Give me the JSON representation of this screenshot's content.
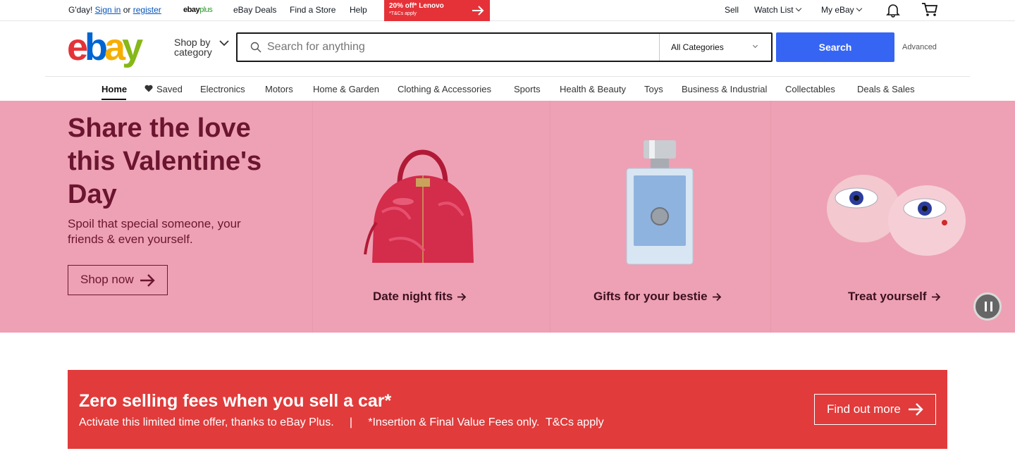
{
  "topbar": {
    "greeting": "G'day!",
    "sign_in": "Sign in",
    "or": "or",
    "register": "register",
    "ebay_plus_brand": "ebay",
    "ebay_plus_suffix": "plus",
    "links": [
      "eBay Deals",
      "Find a Store",
      "Help"
    ],
    "promo_line1": "20% off* Lenovo",
    "promo_line2": "*T&Cs apply",
    "sell": "Sell",
    "watch_list": "Watch List",
    "my_ebay": "My eBay"
  },
  "header": {
    "logo_letters": [
      "e",
      "b",
      "a",
      "y"
    ],
    "shop_by_line1": "Shop by",
    "shop_by_line2": "category",
    "search_placeholder": "Search for anything",
    "category_selected": "All Categories",
    "search_button": "Search",
    "advanced": "Advanced"
  },
  "nav": {
    "items": [
      "Home",
      "Saved",
      "Electronics",
      "Motors",
      "Home & Garden",
      "Clothing & Accessories",
      "Sports",
      "Health & Beauty",
      "Toys",
      "Business & Industrial",
      "Collectables",
      "Deals & Sales"
    ],
    "active": "Home"
  },
  "hero": {
    "title": "Share the love this Valentine's Day",
    "subtitle": "Spoil that special someone, your friends & even yourself.",
    "cta": "Shop now",
    "tiles": [
      "Date night fits",
      "Gifts for your bestie",
      "Treat yourself"
    ]
  },
  "banner": {
    "title": "Zero selling fees when you sell a car*",
    "subtitle": "Activate this limited time offer, thanks to eBay Plus.     |     *Insertion & Final Value Fees only.  T&Cs apply",
    "cta": "Find out more"
  },
  "colors": {
    "hero_bg": "#eea1b4",
    "hero_text": "#6b1530",
    "search_blue": "#3665f3",
    "banner_red": "#e13b3b",
    "promo_red": "#e53238"
  }
}
